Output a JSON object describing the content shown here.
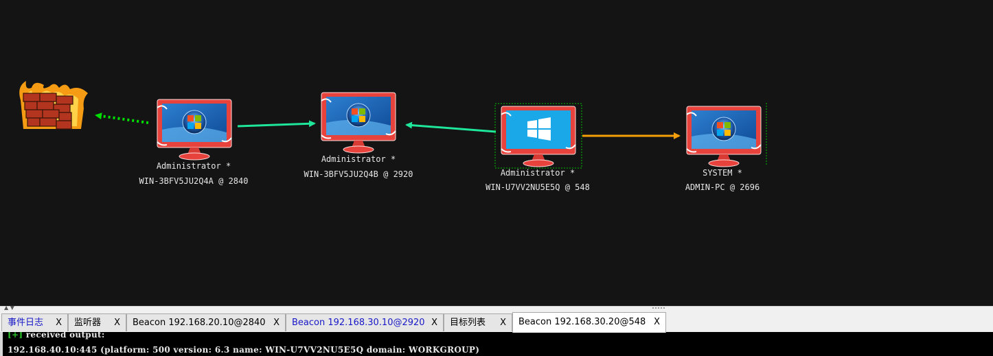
{
  "graph": {
    "firewall": {
      "icon": "firewall-icon"
    },
    "nodes": [
      {
        "id": "node1",
        "user": "Administrator *",
        "host": "WIN-3BFV5JU2Q4A @ 2840",
        "os": "windows-7"
      },
      {
        "id": "node2",
        "user": "Administrator *",
        "host": "WIN-3BFV5JU2Q4B @ 2920",
        "os": "windows-7"
      },
      {
        "id": "node3",
        "user": "Administrator *",
        "host": "WIN-U7VV2NU5E5Q @ 548",
        "os": "windows-10",
        "selected": true
      },
      {
        "id": "node4",
        "user": "SYSTEM *",
        "host": "ADMIN-PC @ 2696",
        "os": "windows-7"
      }
    ],
    "edges": [
      {
        "from": "node1",
        "to": "firewall",
        "style": "dotted",
        "color": "#00e000"
      },
      {
        "from": "node1",
        "to": "node2",
        "style": "solid",
        "color": "#1ee69a"
      },
      {
        "from": "node3",
        "to": "node2",
        "style": "solid",
        "color": "#1ee69a"
      },
      {
        "from": "node3",
        "to": "node4",
        "style": "solid",
        "color": "#f5a00a"
      }
    ]
  },
  "tabs": [
    {
      "label": "事件日志",
      "close": "X",
      "color": "#1818c8"
    },
    {
      "label": "监听器",
      "close": "X"
    },
    {
      "label": "Beacon 192.168.20.10@2840",
      "close": "X"
    },
    {
      "label": "Beacon 192.168.30.10@2920",
      "close": "X",
      "color": "#1818c8"
    },
    {
      "label": "目标列表",
      "close": "X"
    },
    {
      "label": "Beacon 192.168.30.20@548",
      "close": "X",
      "active": true
    }
  ],
  "console": {
    "tag": "[+]",
    "line1": " received output:",
    "line2": "192.168.40.10:445 (platform: 500 version: 6.3 name: WIN-U7VV2NU5E5Q domain: WORKGROUP)"
  }
}
